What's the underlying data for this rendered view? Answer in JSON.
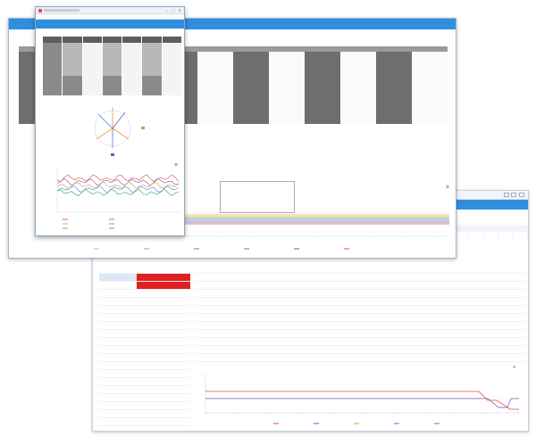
{
  "colors": {
    "header_blue": "#2f8fdf",
    "alarm_red": "#e02020",
    "series_red": "#e24848",
    "series_purple": "#7a4fc2",
    "series_orange": "#e5953a",
    "series_blue": "#4a7be0",
    "series_green": "#3aa05a",
    "series_yellow": "#d8c240"
  },
  "front_window": {
    "title_bar_text": "",
    "header_title": "",
    "phasor_legend": "",
    "chart_title": "",
    "table_rows": 9,
    "close_glyph": "✕",
    "minimize_glyph": "–",
    "maximize_glyph": "□"
  },
  "middle_window": {
    "header_title": "",
    "tooltip_lines": [
      "",
      "",
      "",
      "",
      "",
      ""
    ]
  },
  "back_window": {
    "chart_title": "",
    "close_glyph": "✕"
  },
  "icons": {
    "settings": "gear-icon",
    "close": "close-icon",
    "minimize": "minimize-icon",
    "maximize": "maximize-icon"
  }
}
